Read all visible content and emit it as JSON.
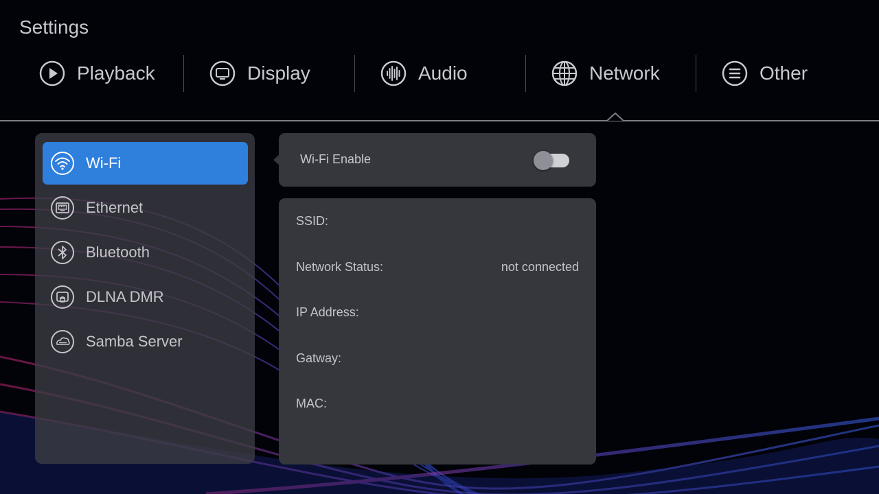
{
  "app": {
    "title": "Settings"
  },
  "tabs": [
    {
      "id": "playback",
      "label": "Playback",
      "icon": "play-circle-icon"
    },
    {
      "id": "display",
      "label": "Display",
      "icon": "monitor-icon"
    },
    {
      "id": "audio",
      "label": "Audio",
      "icon": "audio-wave-icon"
    },
    {
      "id": "network",
      "label": "Network",
      "icon": "globe-icon",
      "selected": true
    },
    {
      "id": "other",
      "label": "Other",
      "icon": "menu-lines-icon"
    }
  ],
  "sidebar": {
    "items": [
      {
        "id": "wifi",
        "label": "Wi-Fi",
        "icon": "wifi-icon",
        "selected": true
      },
      {
        "id": "ethernet",
        "label": "Ethernet",
        "icon": "ethernet-port-icon"
      },
      {
        "id": "bluetooth",
        "label": "Bluetooth",
        "icon": "bluetooth-icon"
      },
      {
        "id": "dlna",
        "label": "DLNA DMR",
        "icon": "dlna-icon"
      },
      {
        "id": "samba",
        "label": "Samba Server",
        "icon": "cloud-server-icon"
      }
    ]
  },
  "wifi_panel": {
    "enable_label": "Wi-Fi Enable",
    "enabled": false
  },
  "info_panel": {
    "rows": [
      {
        "label": "SSID:",
        "value": ""
      },
      {
        "label": "Network Status:",
        "value": "not connected"
      },
      {
        "label": "IP Address:",
        "value": ""
      },
      {
        "label": "Gatway:",
        "value": ""
      },
      {
        "label": "MAC:",
        "value": ""
      }
    ]
  },
  "colors": {
    "accent": "#2f7fdd",
    "panel": "#35373c",
    "background": "#020309"
  }
}
